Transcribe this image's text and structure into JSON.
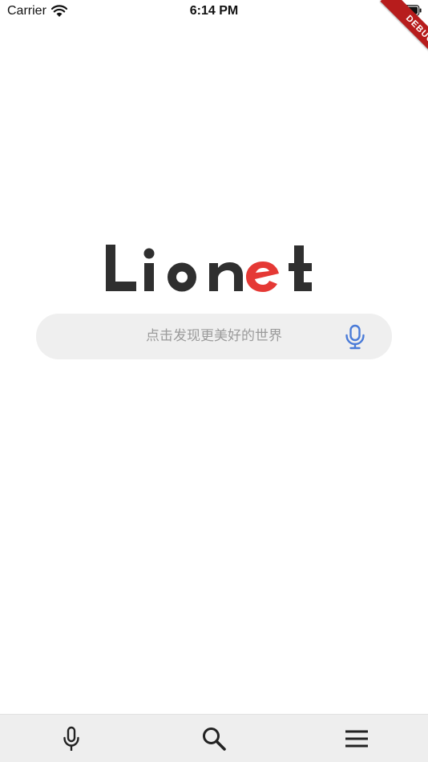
{
  "status_bar": {
    "carrier": "Carrier",
    "time": "6:14 PM",
    "icons": [
      "wifi-icon",
      "battery-icon"
    ]
  },
  "debug_banner": {
    "label": "DEBUG",
    "color": "#b71c1c"
  },
  "logo": {
    "text": "Lionet",
    "colors": {
      "primary": "#2f2f2f",
      "accent": "#e53935"
    }
  },
  "search": {
    "placeholder": "点击发现更美好的世界",
    "mic_icon": "microphone-icon",
    "mic_color": "#4a7bd8"
  },
  "bottom_nav": {
    "items": [
      {
        "icon": "microphone-icon"
      },
      {
        "icon": "search-icon"
      },
      {
        "icon": "menu-icon"
      }
    ]
  },
  "colors": {
    "background": "#ffffff",
    "search_bg": "#efefef",
    "nav_bg": "#eeeeee"
  }
}
